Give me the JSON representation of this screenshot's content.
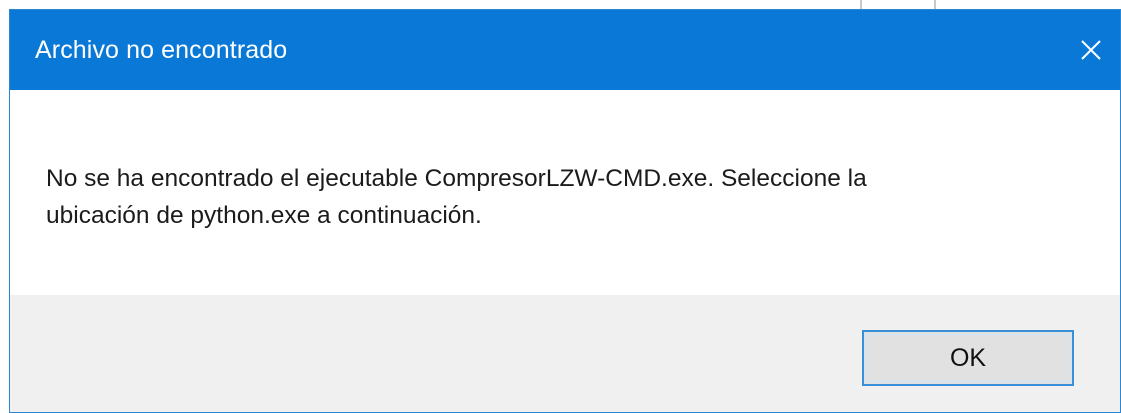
{
  "dialog": {
    "title": "Archivo no encontrado",
    "close_icon": "close-icon",
    "message_line1": "No se ha encontrado el ejecutable CompresorLZW-CMD.exe. Seleccione la",
    "message_line2": "ubicación de python.exe a continuación.",
    "ok_label": "OK"
  },
  "colors": {
    "titlebar": "#0a78d7",
    "footer": "#f0f0f0",
    "button_border": "#3a8fd9"
  }
}
